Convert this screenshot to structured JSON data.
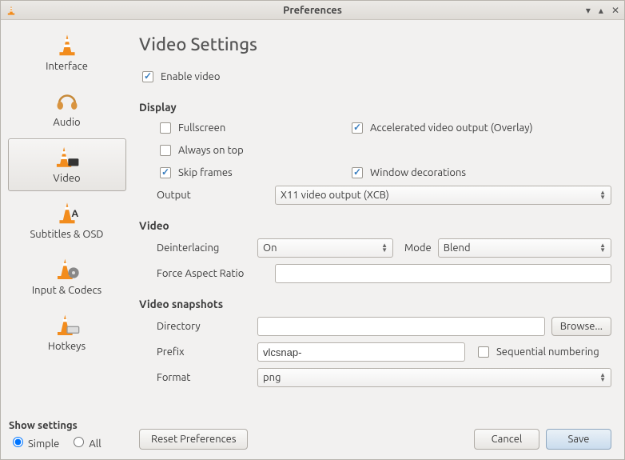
{
  "window": {
    "title": "Preferences"
  },
  "sidebar": {
    "items": [
      {
        "label": "Interface"
      },
      {
        "label": "Audio"
      },
      {
        "label": "Video"
      },
      {
        "label": "Subtitles & OSD"
      },
      {
        "label": "Input & Codecs"
      },
      {
        "label": "Hotkeys"
      }
    ]
  },
  "show_settings": {
    "header": "Show settings",
    "opt_simple": "Simple",
    "opt_all": "All"
  },
  "page": {
    "title": "Video Settings",
    "enable_video": "Enable video",
    "display_header": "Display",
    "fullscreen": "Fullscreen",
    "accel": "Accelerated video output (Overlay)",
    "always_top": "Always on top",
    "skip_frames": "Skip frames",
    "window_dec": "Window decorations",
    "output_label": "Output",
    "output_value": "X11 video output (XCB)",
    "video_header": "Video",
    "deint_label": "Deinterlacing",
    "deint_value": "On",
    "mode_label": "Mode",
    "mode_value": "Blend",
    "force_ar_label": "Force Aspect Ratio",
    "force_ar_value": "",
    "snap_header": "Video snapshots",
    "dir_label": "Directory",
    "dir_value": "",
    "browse": "Browse...",
    "prefix_label": "Prefix",
    "prefix_value": "vlcsnap-",
    "seq_num": "Sequential numbering",
    "format_label": "Format",
    "format_value": "png"
  },
  "footer": {
    "reset": "Reset Preferences",
    "cancel": "Cancel",
    "save": "Save"
  }
}
